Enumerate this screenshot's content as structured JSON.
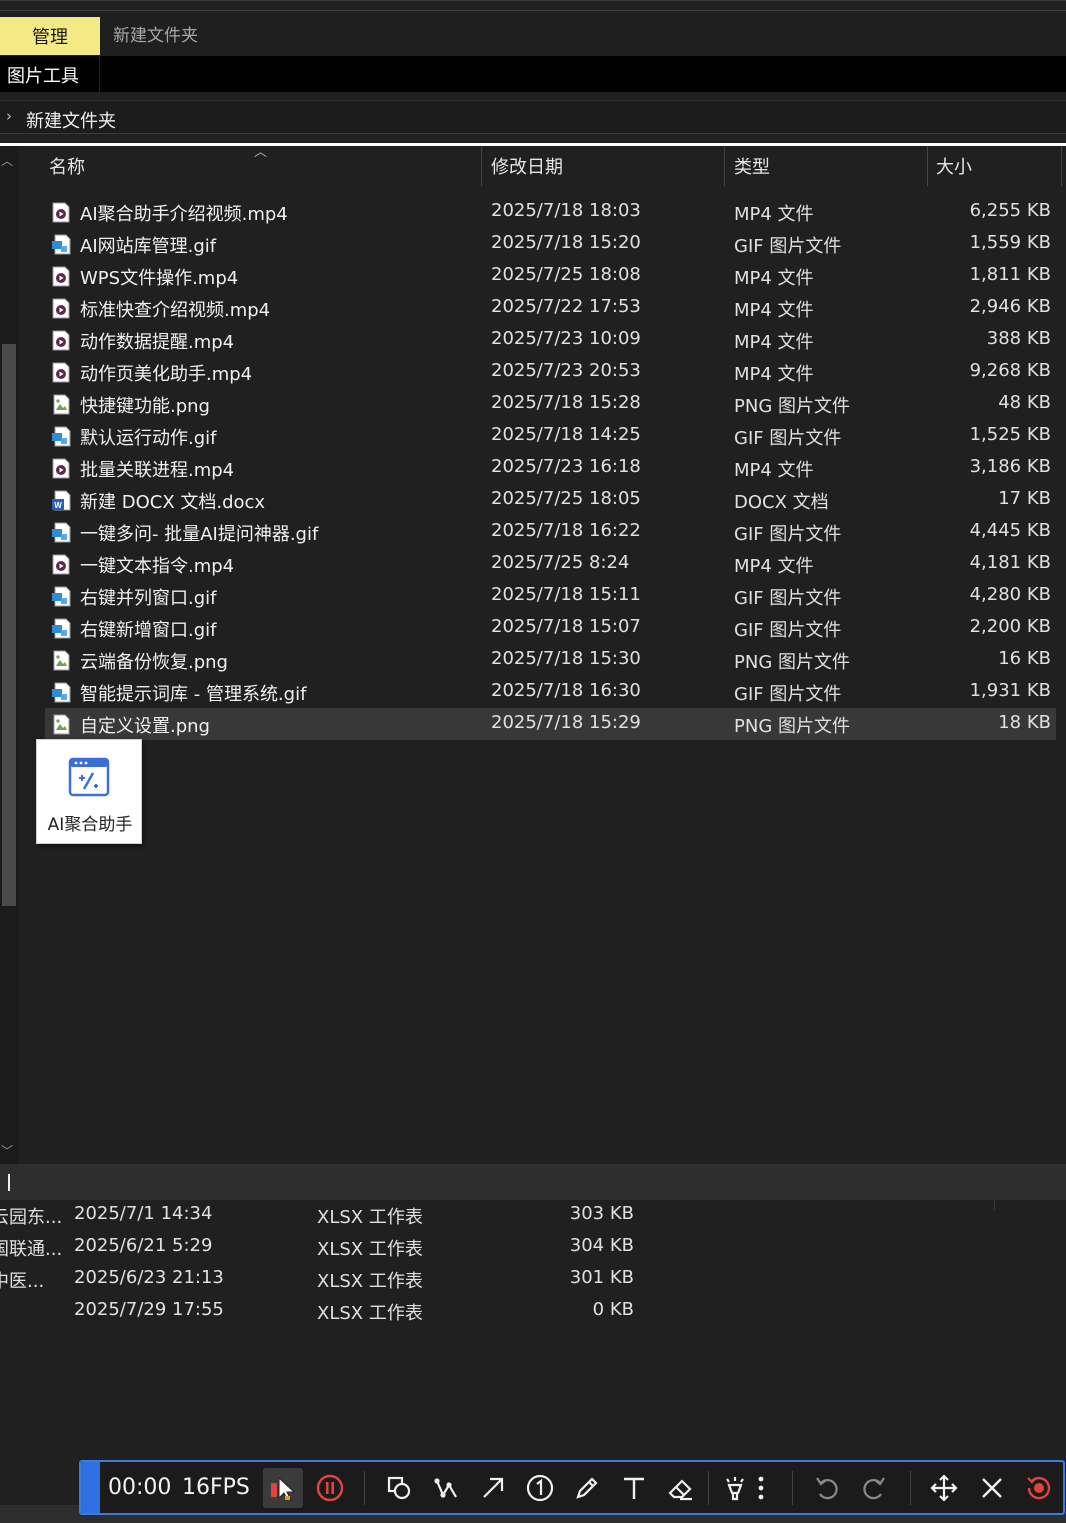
{
  "ribbon": {
    "tab_manage": "管理",
    "tab_folder": "新建文件夹",
    "sub_label": "图片工具"
  },
  "address": {
    "crumb": "新建文件夹"
  },
  "columns": {
    "name": "名称",
    "date": "修改日期",
    "type": "类型",
    "size": "大小"
  },
  "files": [
    {
      "name": "AI聚合助手介绍视频.mp4",
      "date": "2025/7/18 18:03",
      "type": "MP4 文件",
      "size": "6,255 KB",
      "icon": "video"
    },
    {
      "name": "AI网站库管理.gif",
      "date": "2025/7/18 15:20",
      "type": "GIF 图片文件",
      "size": "1,559 KB",
      "icon": "gif"
    },
    {
      "name": "WPS文件操作.mp4",
      "date": "2025/7/25 18:08",
      "type": "MP4 文件",
      "size": "1,811 KB",
      "icon": "video"
    },
    {
      "name": "标准快查介绍视频.mp4",
      "date": "2025/7/22 17:53",
      "type": "MP4 文件",
      "size": "2,946 KB",
      "icon": "video"
    },
    {
      "name": "动作数据提醒.mp4",
      "date": "2025/7/23 10:09",
      "type": "MP4 文件",
      "size": "388 KB",
      "icon": "video"
    },
    {
      "name": "动作页美化助手.mp4",
      "date": "2025/7/23 20:53",
      "type": "MP4 文件",
      "size": "9,268 KB",
      "icon": "video"
    },
    {
      "name": "快捷键功能.png",
      "date": "2025/7/18 15:28",
      "type": "PNG 图片文件",
      "size": "48 KB",
      "icon": "png"
    },
    {
      "name": "默认运行动作.gif",
      "date": "2025/7/18 14:25",
      "type": "GIF 图片文件",
      "size": "1,525 KB",
      "icon": "gif"
    },
    {
      "name": "批量关联进程.mp4",
      "date": "2025/7/23 16:18",
      "type": "MP4 文件",
      "size": "3,186 KB",
      "icon": "video"
    },
    {
      "name": "新建 DOCX 文档.docx",
      "date": "2025/7/25 18:05",
      "type": "DOCX 文档",
      "size": "17 KB",
      "icon": "docx"
    },
    {
      "name": "一键多问- 批量AI提问神器.gif",
      "date": "2025/7/18 16:22",
      "type": "GIF 图片文件",
      "size": "4,445 KB",
      "icon": "gif"
    },
    {
      "name": "一键文本指令.mp4",
      "date": "2025/7/25 8:24",
      "type": "MP4 文件",
      "size": "4,181 KB",
      "icon": "video"
    },
    {
      "name": "右键并列窗口.gif",
      "date": "2025/7/18 15:11",
      "type": "GIF 图片文件",
      "size": "4,280 KB",
      "icon": "gif"
    },
    {
      "name": "右键新增窗口.gif",
      "date": "2025/7/18 15:07",
      "type": "GIF 图片文件",
      "size": "2,200 KB",
      "icon": "gif"
    },
    {
      "name": "云端备份恢复.png",
      "date": "2025/7/18 15:30",
      "type": "PNG 图片文件",
      "size": "16 KB",
      "icon": "png"
    },
    {
      "name": "智能提示词库 - 管理系统.gif",
      "date": "2025/7/18 16:30",
      "type": "GIF 图片文件",
      "size": "1,931 KB",
      "icon": "gif"
    },
    {
      "name": "自定义设置.png",
      "date": "2025/7/18 15:29",
      "type": "PNG 图片文件",
      "size": "18 KB",
      "icon": "png",
      "selected": true
    }
  ],
  "drag_card": {
    "label": "AI聚合助手"
  },
  "bottom_files": [
    {
      "name": "云园东...",
      "date": "2025/7/1 14:34",
      "type": "XLSX 工作表",
      "size": "303 KB"
    },
    {
      "name": "国联通...",
      "date": "2025/6/21 5:29",
      "type": "XLSX 工作表",
      "size": "304 KB"
    },
    {
      "name": "中医...",
      "date": "2025/6/23 21:13",
      "type": "XLSX 工作表",
      "size": "301 KB"
    },
    {
      "name": "",
      "date": "2025/7/29 17:55",
      "type": "XLSX 工作表",
      "size": "0 KB"
    }
  ],
  "recorder": {
    "time": "00:00",
    "fps": "16FPS",
    "accent": "#3a7be0",
    "record_color": "#e0443e"
  }
}
